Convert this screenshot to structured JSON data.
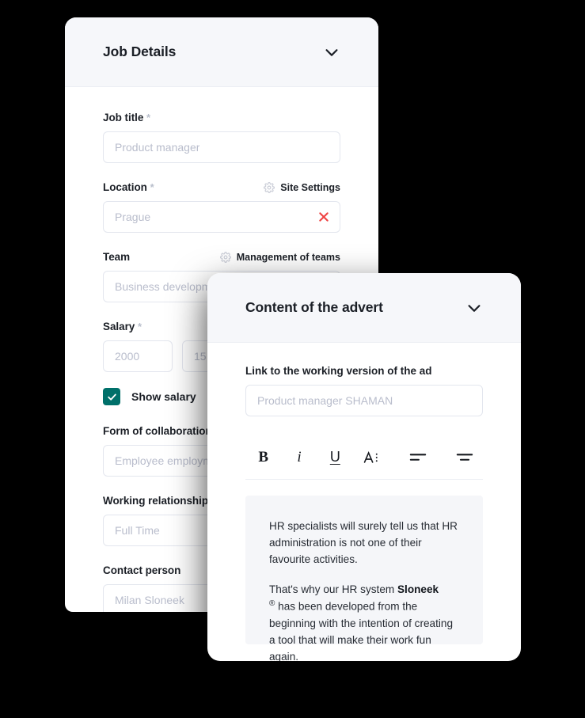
{
  "theme": {
    "page_bg": "#000000",
    "card_bg": "#ffffff",
    "header_bg": "#f6f7fa",
    "accent_teal": "#00706a",
    "danger_red": "#ef4444",
    "placeholder": "#b9bdcc",
    "editor_bg": "#f5f6f9"
  },
  "job_details": {
    "title": "Job Details",
    "collapse_icon": "chevron-down-icon",
    "fields": {
      "job_title": {
        "label": "Job title",
        "required_marker": "*",
        "placeholder": "Product manager"
      },
      "location": {
        "label": "Location",
        "required_marker": "*",
        "placeholder": "Prague",
        "side_action": "Site Settings",
        "side_icon": "gear-icon",
        "clear_icon": "close-icon"
      },
      "team": {
        "label": "Team",
        "required_marker": "",
        "placeholder": "Business development team",
        "side_action": "Management of teams",
        "side_icon": "gear-icon",
        "clear_icon": "close-icon"
      },
      "salary": {
        "label": "Salary",
        "required_marker": "*",
        "placeholder_from": "2000",
        "placeholder_to": "15"
      },
      "show_salary": {
        "label": "Show salary",
        "checked": true,
        "check_icon": "check-icon"
      },
      "form_of_collaboration": {
        "label": "Form of collaboration",
        "placeholder": "Employee employment"
      },
      "working_relationship": {
        "label": "Working relationship",
        "placeholder": "Full Time"
      },
      "contact_person": {
        "label": "Contact person",
        "placeholder": "Milan Sloneek"
      }
    }
  },
  "advert": {
    "title": "Content of the advert",
    "collapse_icon": "chevron-down-icon",
    "link_field": {
      "label": "Link to the working version of the ad",
      "placeholder": "Product manager SHAMAN"
    },
    "toolbar": [
      {
        "name": "bold-icon",
        "label": "B"
      },
      {
        "name": "italic-icon",
        "label": "i"
      },
      {
        "name": "underline-icon",
        "label": "U"
      },
      {
        "name": "text-style-icon",
        "label": "A"
      },
      {
        "name": "align-left-icon",
        "label": ""
      },
      {
        "name": "align-center-icon",
        "label": ""
      }
    ],
    "editor": {
      "paragraph_1": "HR specialists will surely tell us that HR administration is not one of their favourite activities.",
      "paragraph_2_pre": "That's why our HR system ",
      "paragraph_2_brand": "Sloneek",
      "paragraph_2_reg": "®",
      "paragraph_2_post": " has been developed from the beginning with the intention of creating a tool that will make their work fun again."
    }
  }
}
